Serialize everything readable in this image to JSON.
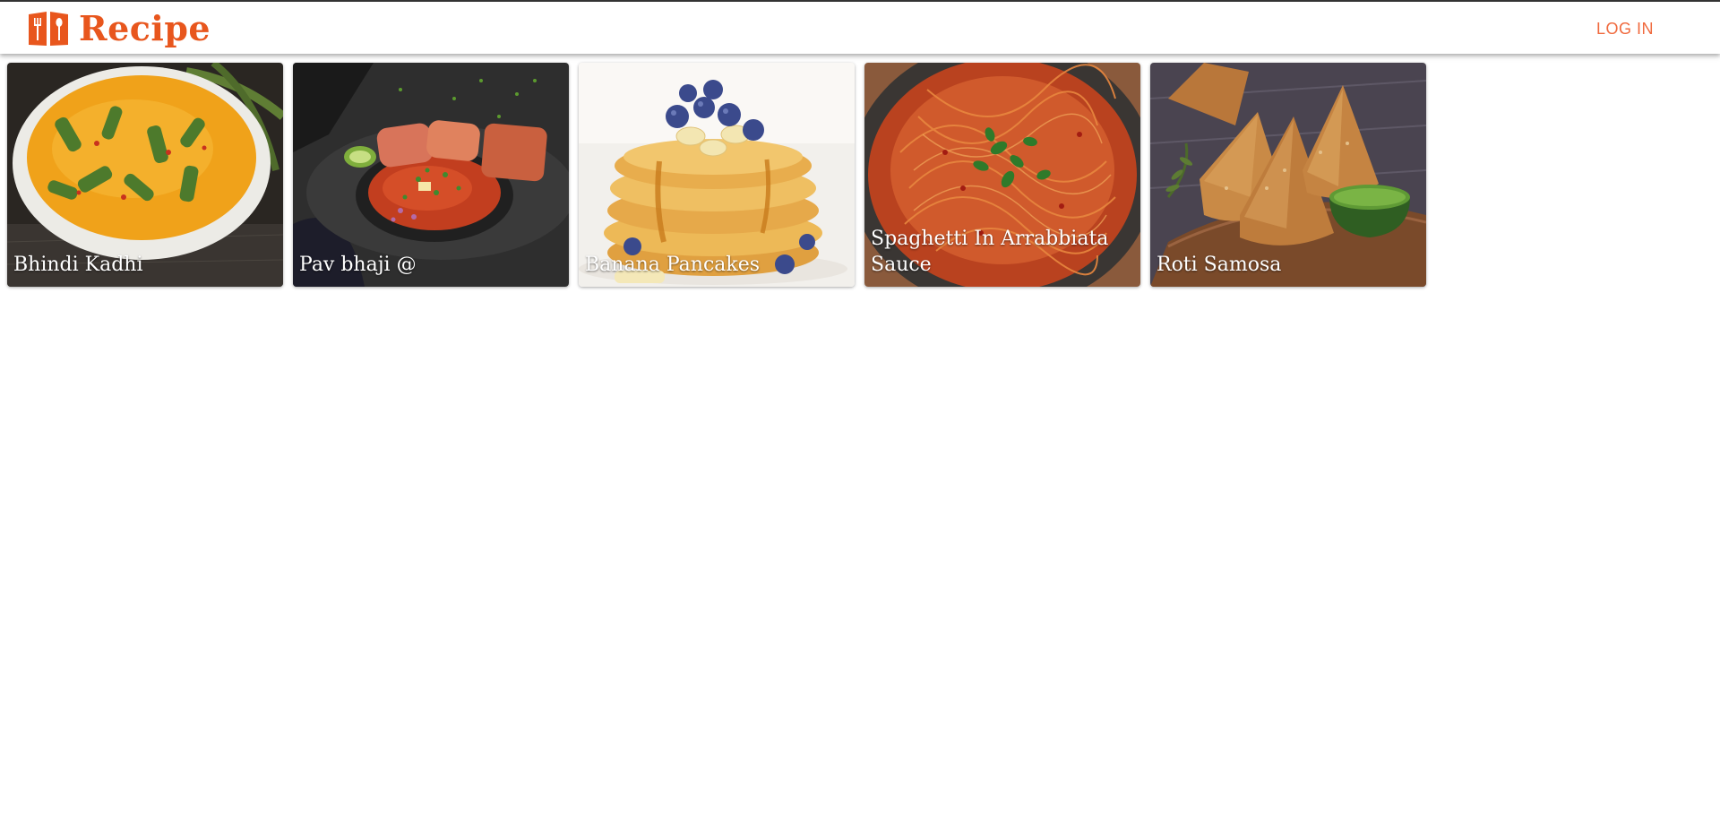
{
  "header": {
    "brand_title": "Recipe",
    "brand_icon": "recipe-book-icon",
    "login_label": "LOG IN"
  },
  "colors": {
    "brand": "#e8561d",
    "login_text": "#f06a3e",
    "title_text": "#ffffff"
  },
  "recipes": [
    {
      "title": "Bhindi Kadhi"
    },
    {
      "title": "Pav bhaji @"
    },
    {
      "title": "Banana Pancakes"
    },
    {
      "title": "Spaghetti In Arrabbiata Sauce"
    },
    {
      "title": "Roti Samosa"
    }
  ]
}
